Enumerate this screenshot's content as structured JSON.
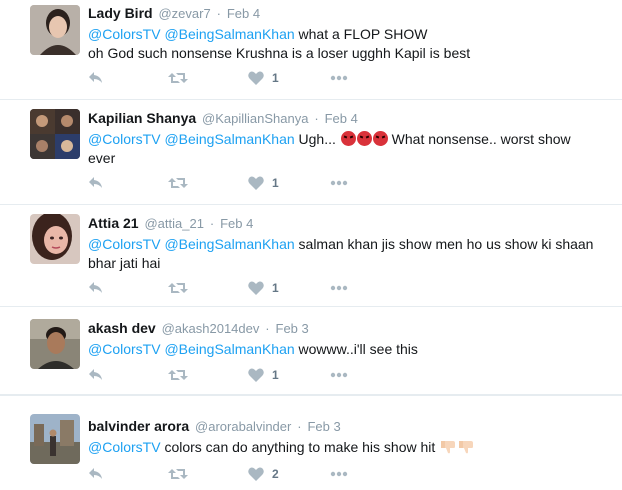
{
  "tweets": [
    {
      "name": "Lady Bird",
      "handle": "@zevar7",
      "sep": "·",
      "date": "Feb 4",
      "mention1": "@ColorsTV",
      "mention2": "@BeingSalmanKhan",
      "text_line1": " what a FLOP SHOW",
      "text_line2": "oh God such nonsense Krushna is a loser ugghh Kapil is best",
      "likes": "1",
      "avatar_icon": "user-photo"
    },
    {
      "name": "Kapilian Shanya",
      "handle": "@KapillianShanya",
      "sep": "·",
      "date": "Feb 4",
      "mention1": "@ColorsTV",
      "mention2": "@BeingSalmanKhan",
      "text_a": " Ugh...",
      "text_b": " What nonsense.. worst show",
      "text_line2": "ever",
      "likes": "1",
      "emoji": "angry-face-icon"
    },
    {
      "name": "Attia 21",
      "handle": "@attia_21",
      "sep": "·",
      "date": "Feb 4",
      "mention1": "@ColorsTV",
      "mention2": "@BeingSalmanKhan",
      "text_line1": " salman khan jis show men ho us show ki shaan",
      "text_line2": "bhar jati hai",
      "likes": "1"
    },
    {
      "name": "akash dev",
      "handle": "@akash2014dev",
      "sep": "·",
      "date": "Feb 3",
      "mention1": "@ColorsTV",
      "mention2": "@BeingSalmanKhan",
      "text_line1": " wowww..i'll see this",
      "likes": "1"
    },
    {
      "name": "balvinder arora",
      "handle": "@arorabalvinder",
      "sep": "·",
      "date": "Feb 3",
      "mention1": "@ColorsTV",
      "text_line1": " colors can do anything to make his show hit",
      "likes": "2",
      "emoji": "thumbs-down-icon"
    }
  ],
  "colors": {
    "link": "#1da1f2",
    "muted": "#8899a6",
    "action": "#aab8c2",
    "divider": "#e6ecf0"
  },
  "icons": [
    "reply-icon",
    "retweet-icon",
    "heart-icon",
    "more-icon"
  ]
}
